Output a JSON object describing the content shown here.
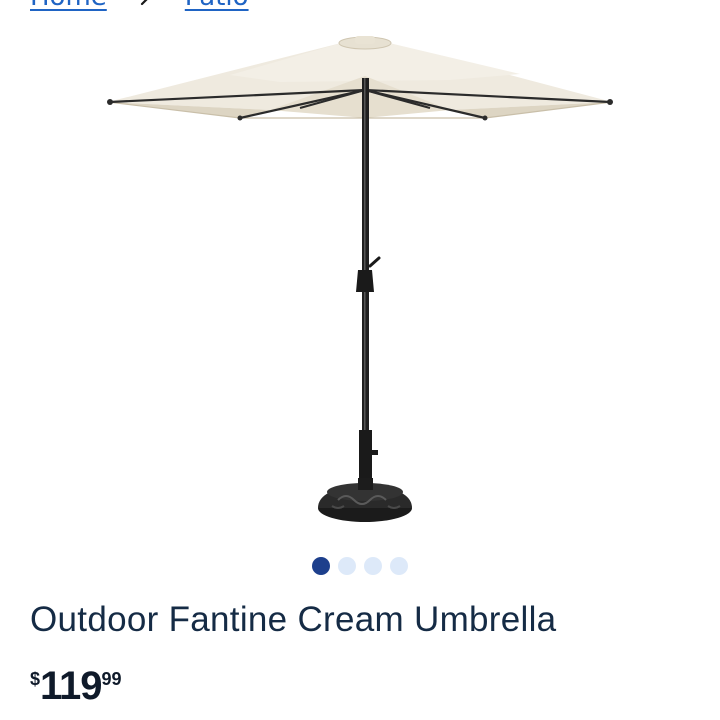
{
  "breadcrumb": {
    "items": [
      {
        "label": "Home"
      },
      {
        "label": "Patio"
      }
    ]
  },
  "product": {
    "title": "Outdoor Fantine Cream Umbrella",
    "price": {
      "currency_symbol": "$",
      "dollars": "119",
      "cents": "99"
    },
    "image_alt": "Cream patio umbrella with dark pole and round base"
  },
  "carousel": {
    "total": 4,
    "active_index": 0
  },
  "colors": {
    "link": "#1f64c4",
    "title": "#152b45",
    "dot_active": "#1d3f8c",
    "dot_inactive": "#dde9f9",
    "canopy": "#ece6d8",
    "pole": "#1e1e1e"
  }
}
